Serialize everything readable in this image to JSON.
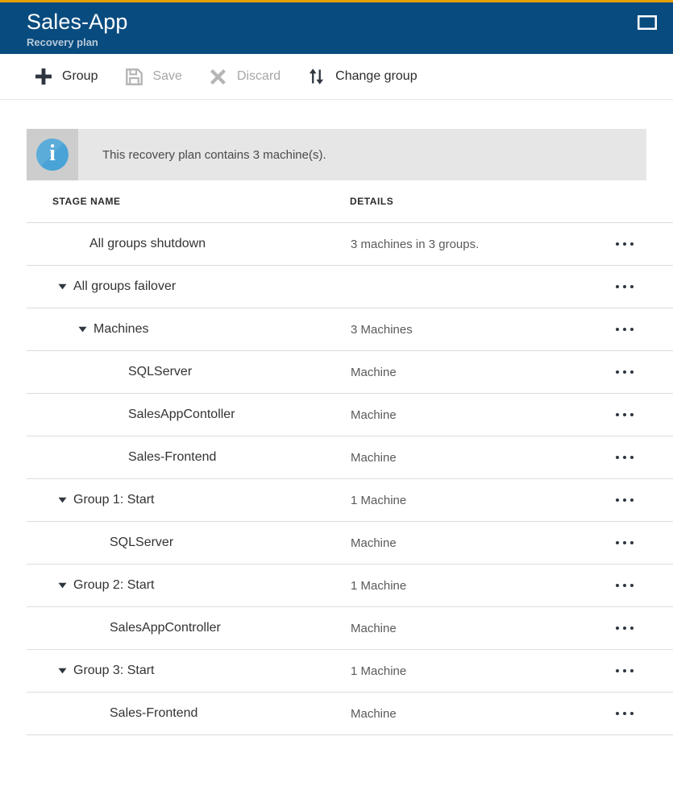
{
  "header": {
    "title": "Sales-App",
    "subtitle": "Recovery plan",
    "window_control_icon": "restore-window-icon",
    "background_color": "#084b7f",
    "accent_color": "#e8a000"
  },
  "toolbar": {
    "buttons": [
      {
        "label": "Group",
        "icon": "plus-icon",
        "enabled": true
      },
      {
        "label": "Save",
        "icon": "save-disk-icon",
        "enabled": false
      },
      {
        "label": "Discard",
        "icon": "cross-icon",
        "enabled": false
      },
      {
        "label": "Change group",
        "icon": "swap-arrows-icon",
        "enabled": true
      }
    ]
  },
  "info_banner": {
    "icon": "info-icon",
    "message": "This recovery plan contains 3 machine(s).",
    "icon_color": "#4aa3d6",
    "background_color": "#e6e6e6"
  },
  "grid": {
    "columns": {
      "stage": "STAGE NAME",
      "details": "DETAILS"
    },
    "row_action_icon": "ellipsis-icon",
    "rows": [
      {
        "name": "All groups shutdown",
        "details": "3 machines in 3 groups.",
        "level": 0,
        "expander": "none"
      },
      {
        "name": "All groups failover",
        "details": "",
        "level": 1,
        "expander": "expanded"
      },
      {
        "name": "Machines",
        "details": "3 Machines",
        "level": 2,
        "expander": "expanded"
      },
      {
        "name": "SQLServer",
        "details": "Machine",
        "level": 3,
        "expander": "none"
      },
      {
        "name": "SalesAppContoller",
        "details": "Machine",
        "level": 3,
        "expander": "none"
      },
      {
        "name": "Sales-Frontend",
        "details": "Machine",
        "level": 3,
        "expander": "none"
      },
      {
        "name": "Group 1: Start",
        "details": "1 Machine",
        "level": 1,
        "expander": "expanded"
      },
      {
        "name": "SQLServer",
        "details": "Machine",
        "level": 2,
        "expander": "none"
      },
      {
        "name": "Group 2: Start",
        "details": "1 Machine",
        "level": 1,
        "expander": "expanded"
      },
      {
        "name": "SalesAppController",
        "details": "Machine",
        "level": 2,
        "expander": "none"
      },
      {
        "name": "Group 3: Start",
        "details": "1 Machine",
        "level": 1,
        "expander": "expanded"
      },
      {
        "name": "Sales-Frontend",
        "details": "Machine",
        "level": 2,
        "expander": "none"
      }
    ]
  }
}
